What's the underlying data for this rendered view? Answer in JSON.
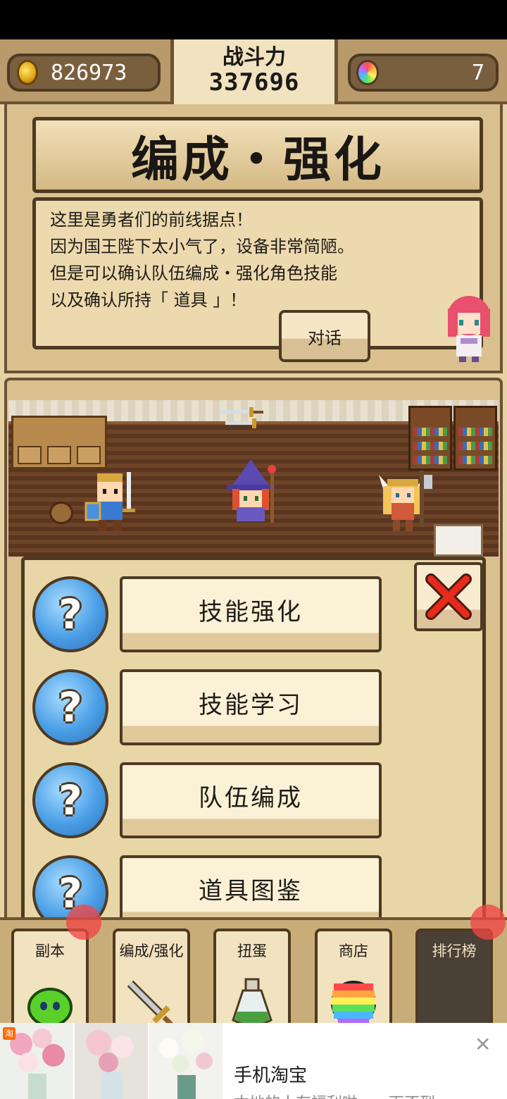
{
  "header": {
    "coins": "826973",
    "power_label": "战斗力",
    "power_value": "337696",
    "gems": "7"
  },
  "panel": {
    "title": "编成・强化",
    "dialog_lines": [
      "这里是勇者们的前线据点！",
      "因为国王陛下太小气了，设备非常简陋。",
      "但是可以确认队伍编成・强化角色技能",
      "以及确认所持「 道具 」！"
    ],
    "talk_button": "对话"
  },
  "menu": {
    "items": [
      {
        "label": "技能强化",
        "icon": "?"
      },
      {
        "label": "技能学习",
        "icon": "?"
      },
      {
        "label": "队伍编成",
        "icon": "?"
      },
      {
        "label": "道具图鉴",
        "icon": "?"
      }
    ]
  },
  "nav": {
    "tabs": [
      {
        "label": "副本"
      },
      {
        "label": "编成/强化"
      },
      {
        "label": "扭蛋"
      },
      {
        "label": "商店"
      },
      {
        "label": "排行榜"
      }
    ]
  },
  "ad": {
    "badge": "淘",
    "title": "手机淘宝",
    "subtitle": "本地的人有福利啦……下不到"
  },
  "colors": {
    "frame_brown": "#4e3a22",
    "panel_tan": "#d9c08e",
    "button_cream": "#fbf1d6",
    "close_red": "#e52c1c",
    "orb_blue": "#4a9fe6"
  }
}
